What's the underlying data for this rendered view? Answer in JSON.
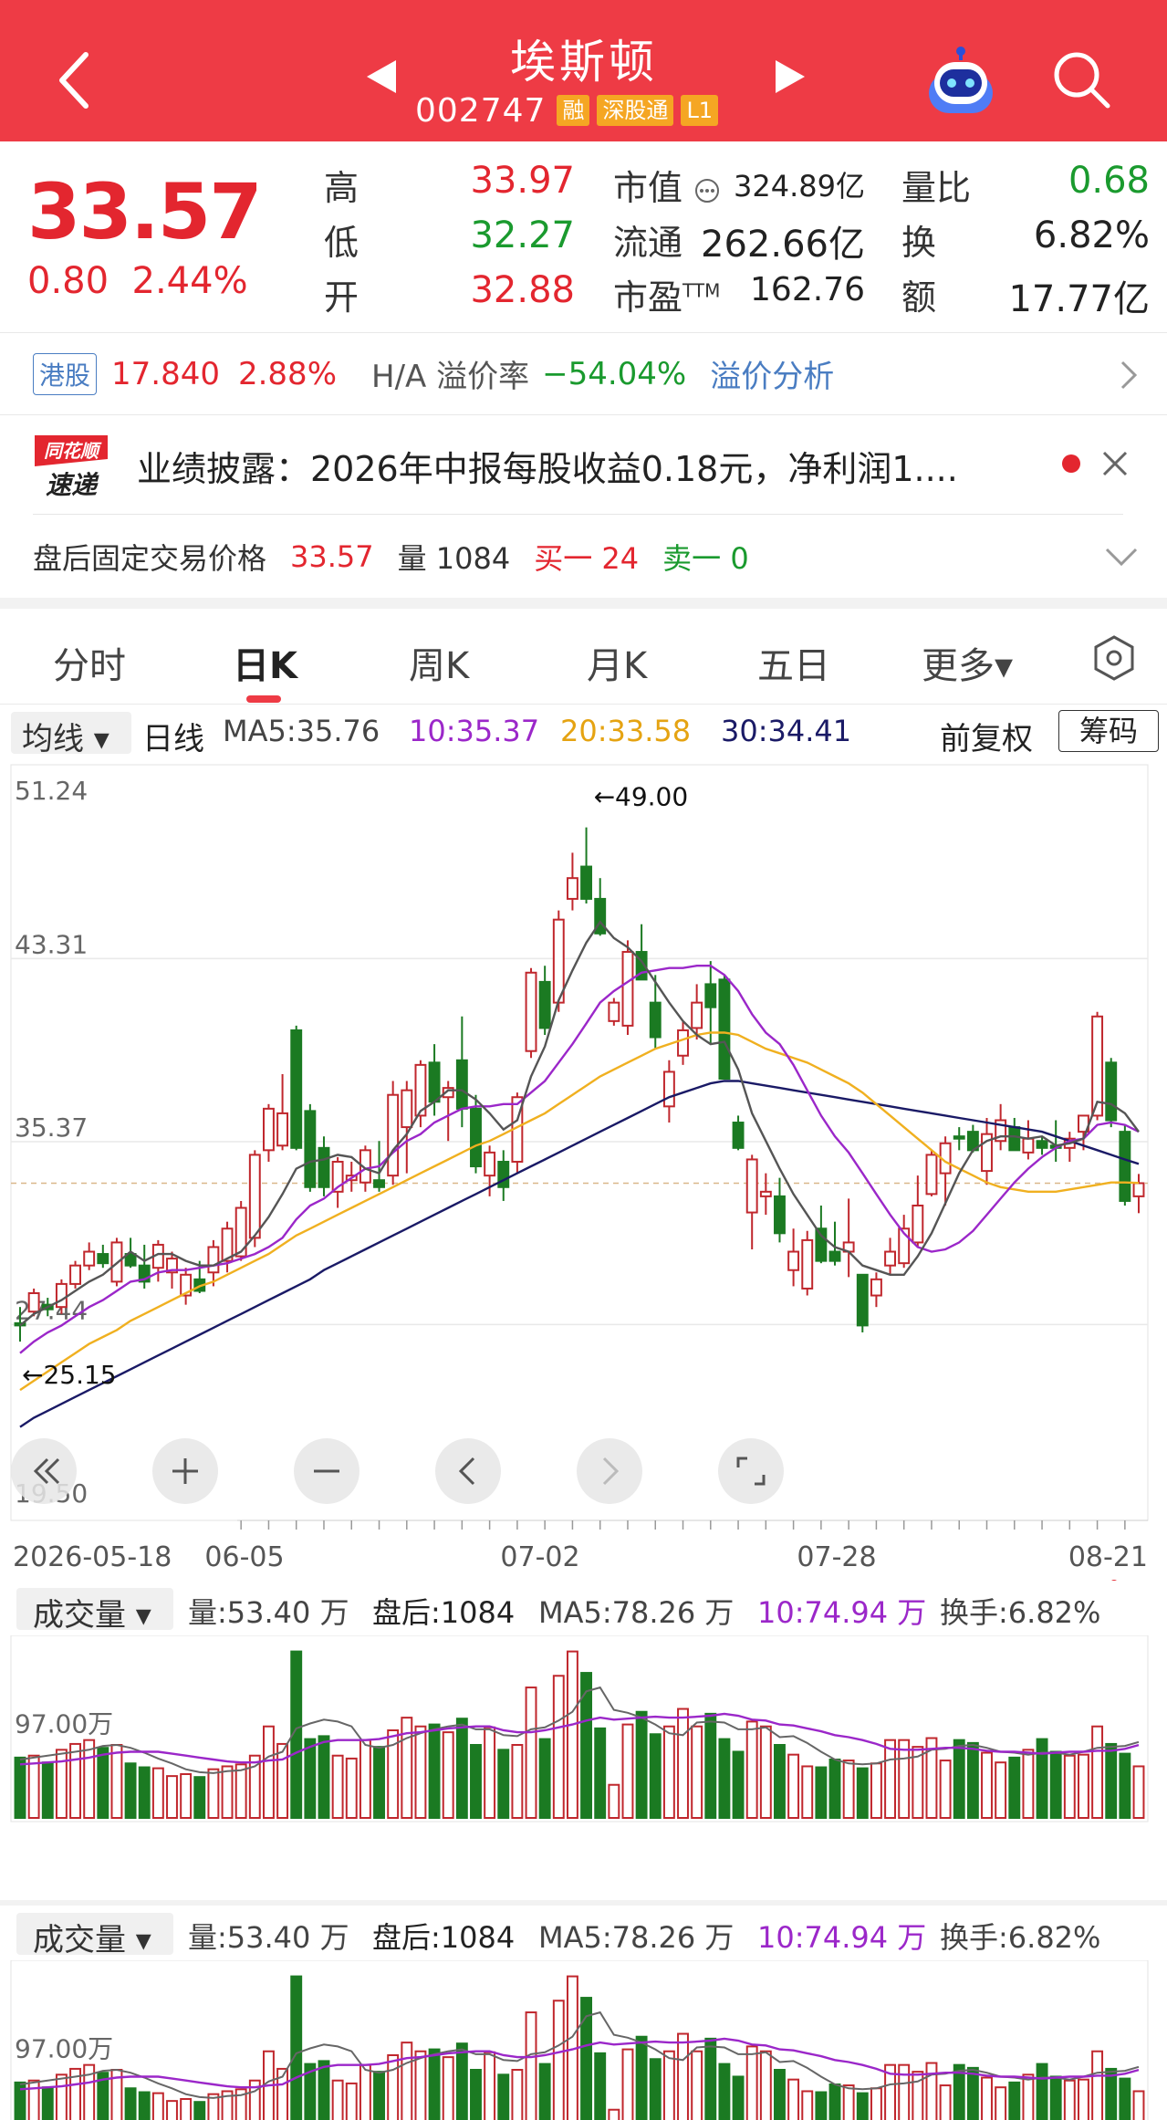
{
  "header": {
    "title": "埃斯顿",
    "code": "002747",
    "badges": [
      "融",
      "深股通",
      "L1"
    ]
  },
  "quote": {
    "price": "33.57",
    "change": "0.80",
    "change_pct": "2.44%",
    "labels": {
      "high": "高",
      "low": "低",
      "open": "开",
      "market_cap": "市值",
      "float_cap": "流通",
      "pe": "市盈",
      "pe_suffix": "TTM",
      "vol_ratio": "量比",
      "turnover": "换",
      "amount": "额"
    },
    "high": "33.97",
    "low": "32.27",
    "open": "32.88",
    "market_cap": "324.89亿",
    "float_cap": "262.66亿",
    "pe": "162.76",
    "vol_ratio": "0.68",
    "turnover": "6.82%",
    "amount": "17.77亿"
  },
  "hk": {
    "badge": "港股",
    "price": "17.840",
    "pct": "2.88%",
    "premium_label": "H/A 溢价率",
    "premium": "−54.04%",
    "link": "溢价分析"
  },
  "news": {
    "logo_top": "同花顺",
    "logo_bottom": "速递",
    "text": "业绩披露：2026年中报每股收益0.18元，净利润1...."
  },
  "afterhours": {
    "label": "盘后固定交易价格",
    "price": "33.57",
    "vol_label": "量 1084",
    "buy": "买一 24",
    "sell": "卖一 0"
  },
  "tabs": [
    "分时",
    "日K",
    "周K",
    "月K",
    "五日",
    "更多▾"
  ],
  "ma_bar": {
    "selector": "均线 ▾",
    "period": "日线",
    "ma5": "MA5:35.76",
    "ma10": "10:35.37",
    "ma20": "20:33.58",
    "ma30": "30:34.41",
    "adjust": "前复权",
    "chip": "筹码"
  },
  "colors": {
    "header": "#ee3b45",
    "up": "#c0272d",
    "down": "#1b7a22",
    "ma5": "#555555",
    "ma10": "#9b27c9",
    "ma20": "#f0b020",
    "ma30": "#1a1a66"
  },
  "chart_data": {
    "type": "candlestick",
    "y_ticks": [
      "51.24",
      "43.31",
      "35.37",
      "27.44",
      "19.50"
    ],
    "ylim": [
      19.5,
      51.24
    ],
    "x_ticks": [
      "2026-05-18",
      "06-05",
      "07-02",
      "07-28",
      "08-21"
    ],
    "max_label": "←49.00",
    "min_label": "←25.15",
    "ref_price": 33.57,
    "candles": [
      [
        27.5,
        28.2,
        26.7,
        27.4
      ],
      [
        28.0,
        29.0,
        27.8,
        28.8
      ],
      [
        28.3,
        28.6,
        27.8,
        28.1
      ],
      [
        28.2,
        29.4,
        27.9,
        29.2
      ],
      [
        29.2,
        30.2,
        29.0,
        30.0
      ],
      [
        30.0,
        31.0,
        29.8,
        30.6
      ],
      [
        30.5,
        30.9,
        29.9,
        30.1
      ],
      [
        29.3,
        31.2,
        29.1,
        31.0
      ],
      [
        30.5,
        31.2,
        29.9,
        30.0
      ],
      [
        30.0,
        30.9,
        29.0,
        29.3
      ],
      [
        29.9,
        31.1,
        29.3,
        30.9
      ],
      [
        29.7,
        30.6,
        29.0,
        30.3
      ],
      [
        28.7,
        29.9,
        28.3,
        29.6
      ],
      [
        29.4,
        30.2,
        28.8,
        28.9
      ],
      [
        29.7,
        31.1,
        29.1,
        30.8
      ],
      [
        30.2,
        31.9,
        29.7,
        31.6
      ],
      [
        30.4,
        32.8,
        30.2,
        32.5
      ],
      [
        31.2,
        35.0,
        30.8,
        34.8
      ],
      [
        35.0,
        37.0,
        34.5,
        36.8
      ],
      [
        35.2,
        38.3,
        35.0,
        36.6
      ],
      [
        40.2,
        40.4,
        35.0,
        35.1
      ],
      [
        36.7,
        37.0,
        33.2,
        33.4
      ],
      [
        35.1,
        35.6,
        33.0,
        33.4
      ],
      [
        33.2,
        34.7,
        32.5,
        34.5
      ],
      [
        33.7,
        34.5,
        33.2,
        33.9
      ],
      [
        33.6,
        35.2,
        33.2,
        35.0
      ],
      [
        33.7,
        35.4,
        33.2,
        33.4
      ],
      [
        33.9,
        38.0,
        33.5,
        37.4
      ],
      [
        36.0,
        38.0,
        34.0,
        37.6
      ],
      [
        36.5,
        38.9,
        36.0,
        38.7
      ],
      [
        38.8,
        39.6,
        36.5,
        37.1
      ],
      [
        37.3,
        38.0,
        35.4,
        37.7
      ],
      [
        38.9,
        40.8,
        36.0,
        36.8
      ],
      [
        36.8,
        37.4,
        34.0,
        34.3
      ],
      [
        33.9,
        35.2,
        33.0,
        34.9
      ],
      [
        34.5,
        35.0,
        32.8,
        33.4
      ],
      [
        34.5,
        37.5,
        34.0,
        37.3
      ],
      [
        39.3,
        42.9,
        39.0,
        42.7
      ],
      [
        42.3,
        43.0,
        40.0,
        40.3
      ],
      [
        41.4,
        45.4,
        41.0,
        45.0
      ],
      [
        45.9,
        47.9,
        45.4,
        46.8
      ],
      [
        47.3,
        49.0,
        45.7,
        45.9
      ],
      [
        45.9,
        46.8,
        44.3,
        44.4
      ],
      [
        40.6,
        41.6,
        40.4,
        41.4
      ],
      [
        40.4,
        44.1,
        40.0,
        43.6
      ],
      [
        43.6,
        44.8,
        42.4,
        42.4
      ],
      [
        41.4,
        42.6,
        39.4,
        39.9
      ],
      [
        36.9,
        38.9,
        36.2,
        38.4
      ],
      [
        39.1,
        40.6,
        38.7,
        40.2
      ],
      [
        40.3,
        42.2,
        39.8,
        41.4
      ],
      [
        42.2,
        43.2,
        39.6,
        41.2
      ],
      [
        42.4,
        42.6,
        38.1,
        38.1
      ],
      [
        36.2,
        36.5,
        35.0,
        35.1
      ],
      [
        32.3,
        34.8,
        30.7,
        34.6
      ],
      [
        33.0,
        34.0,
        32.2,
        33.2
      ],
      [
        33.0,
        33.8,
        31.0,
        31.4
      ],
      [
        29.8,
        31.6,
        29.1,
        30.6
      ],
      [
        29.0,
        31.5,
        28.7,
        31.1
      ],
      [
        31.6,
        32.6,
        30.1,
        30.2
      ],
      [
        30.6,
        31.9,
        30.0,
        30.2
      ],
      [
        30.6,
        32.9,
        29.5,
        31.0
      ],
      [
        29.6,
        29.6,
        27.1,
        27.4
      ],
      [
        28.7,
        29.7,
        28.2,
        29.4
      ],
      [
        30.0,
        31.2,
        29.6,
        30.6
      ],
      [
        30.1,
        32.2,
        29.9,
        31.6
      ],
      [
        31.0,
        33.9,
        30.8,
        32.6
      ],
      [
        33.1,
        35.0,
        33.0,
        34.8
      ],
      [
        34.0,
        35.6,
        32.6,
        35.3
      ],
      [
        35.6,
        36.0,
        35.0,
        35.5
      ],
      [
        35.8,
        36.1,
        34.9,
        35.0
      ],
      [
        34.1,
        36.4,
        33.5,
        35.7
      ],
      [
        35.4,
        37.0,
        35.0,
        36.3
      ],
      [
        36.0,
        36.4,
        35.0,
        35.0
      ],
      [
        34.9,
        36.3,
        34.6,
        35.5
      ],
      [
        35.4,
        35.6,
        34.8,
        35.1
      ],
      [
        35.2,
        36.3,
        34.5,
        35.1
      ],
      [
        35.1,
        35.8,
        34.5,
        35.5
      ],
      [
        35.8,
        36.2,
        35.0,
        36.5
      ],
      [
        36.5,
        41.0,
        36.3,
        40.8
      ],
      [
        38.8,
        39.0,
        36.0,
        36.3
      ],
      [
        35.8,
        36.1,
        32.6,
        32.8
      ],
      [
        33.0,
        33.97,
        32.27,
        33.57
      ]
    ],
    "ma5": [
      27.4,
      27.9,
      28.2,
      28.5,
      28.9,
      29.3,
      29.6,
      30.1,
      30.6,
      30.2,
      30.5,
      30.5,
      30.2,
      30.0,
      30.0,
      30.3,
      30.6,
      31.3,
      32.1,
      33.1,
      34.2,
      34.5,
      34.6,
      34.8,
      34.7,
      34.2,
      34.0,
      35.0,
      35.7,
      36.7,
      37.1,
      37.6,
      37.6,
      37.2,
      36.6,
      35.9,
      36.3,
      38.2,
      39.5,
      41.5,
      42.8,
      44.0,
      44.9,
      44.2,
      43.8,
      43.2,
      42.3,
      41.4,
      40.6,
      40.0,
      39.6,
      39.7,
      38.5,
      36.6,
      35.4,
      34.2,
      33.1,
      32.2,
      31.3,
      30.8,
      30.6,
      30.0,
      29.8,
      29.6,
      29.6,
      30.4,
      31.4,
      32.7,
      34.0,
      35.0,
      35.4,
      35.6,
      35.6,
      35.5,
      35.6,
      35.2,
      35.3,
      35.5,
      37.1,
      37.0,
      36.6,
      35.8
    ],
    "ma10": [
      26.2,
      26.7,
      27.1,
      27.4,
      27.8,
      28.2,
      28.5,
      28.9,
      29.3,
      29.4,
      29.7,
      29.8,
      29.8,
      29.9,
      30.0,
      30.1,
      30.3,
      30.5,
      30.8,
      31.2,
      32.0,
      32.6,
      32.9,
      33.4,
      33.8,
      34.2,
      34.3,
      34.9,
      35.4,
      35.7,
      36.2,
      36.5,
      36.8,
      36.9,
      36.9,
      37.0,
      37.0,
      37.5,
      38.0,
      38.8,
      39.6,
      40.5,
      41.4,
      41.9,
      42.3,
      42.7,
      42.8,
      42.9,
      42.9,
      43.0,
      43.0,
      42.6,
      41.9,
      40.9,
      40.1,
      39.6,
      38.7,
      37.6,
      36.5,
      35.6,
      34.9,
      34.0,
      33.1,
      32.2,
      31.4,
      30.8,
      30.6,
      30.7,
      31.0,
      31.5,
      32.2,
      32.9,
      33.6,
      34.2,
      34.7,
      35.1,
      35.4,
      35.5,
      36.1,
      36.2,
      36.1,
      35.8
    ],
    "ma20": [
      24.6,
      25.0,
      25.4,
      25.8,
      26.2,
      26.6,
      26.9,
      27.2,
      27.6,
      27.9,
      28.2,
      28.5,
      28.8,
      29.1,
      29.3,
      29.6,
      29.9,
      30.2,
      30.5,
      30.9,
      31.3,
      31.6,
      31.9,
      32.2,
      32.5,
      32.8,
      33.1,
      33.4,
      33.7,
      34.0,
      34.3,
      34.6,
      34.9,
      35.2,
      35.4,
      35.7,
      36.0,
      36.3,
      36.6,
      37.0,
      37.4,
      37.8,
      38.2,
      38.5,
      38.8,
      39.1,
      39.4,
      39.6,
      39.8,
      40.0,
      40.1,
      40.1,
      40.0,
      39.7,
      39.4,
      39.2,
      39.0,
      38.8,
      38.5,
      38.2,
      37.9,
      37.5,
      37.0,
      36.5,
      36.0,
      35.5,
      35.0,
      34.5,
      34.2,
      33.9,
      33.6,
      33.4,
      33.3,
      33.2,
      33.2,
      33.2,
      33.3,
      33.4,
      33.5,
      33.6,
      33.6,
      33.58
    ],
    "ma30": [
      23.0,
      23.4,
      23.7,
      24.0,
      24.3,
      24.6,
      24.9,
      25.2,
      25.5,
      25.8,
      26.1,
      26.4,
      26.7,
      27.0,
      27.3,
      27.6,
      27.9,
      28.2,
      28.5,
      28.8,
      29.1,
      29.4,
      29.8,
      30.1,
      30.4,
      30.7,
      31.0,
      31.3,
      31.6,
      31.9,
      32.2,
      32.5,
      32.8,
      33.1,
      33.4,
      33.7,
      34.0,
      34.3,
      34.6,
      34.9,
      35.2,
      35.5,
      35.8,
      36.1,
      36.4,
      36.7,
      37.0,
      37.3,
      37.5,
      37.7,
      37.9,
      38.0,
      38.0,
      37.9,
      37.8,
      37.7,
      37.6,
      37.5,
      37.4,
      37.3,
      37.2,
      37.1,
      37.0,
      36.9,
      36.8,
      36.7,
      36.6,
      36.5,
      36.4,
      36.3,
      36.2,
      36.1,
      36.0,
      35.9,
      35.8,
      35.6,
      35.4,
      35.2,
      35.0,
      34.8,
      34.6,
      34.41
    ],
    "volume_panels": [
      {
        "selector": "成交量 ▾",
        "vol": "量:53.40 万",
        "after": "盘后:1084",
        "ma5": "MA5:78.26 万",
        "ma10": "10:74.94 万",
        "turnover": "换手:6.82%",
        "y_tick": "97.00万"
      },
      {
        "selector": "成交量 ▾",
        "vol": "量:53.40 万",
        "after": "盘后:1084",
        "ma5": "MA5:78.26 万",
        "ma10": "10:74.94 万",
        "turnover": "换手:6.82%",
        "y_tick": "97.00万"
      }
    ],
    "volumes": [
      62,
      64,
      57,
      70,
      76,
      80,
      72,
      75,
      56,
      52,
      51,
      43,
      45,
      42,
      50,
      53,
      55,
      64,
      94,
      76,
      171,
      81,
      84,
      64,
      61,
      80,
      73,
      90,
      103,
      94,
      96,
      88,
      102,
      75,
      93,
      70,
      75,
      134,
      81,
      146,
      171,
      149,
      92,
      34,
      96,
      109,
      86,
      94,
      112,
      94,
      107,
      81,
      68,
      99,
      94,
      75,
      65,
      53,
      52,
      60,
      59,
      51,
      56,
      80,
      80,
      73,
      82,
      59,
      80,
      77,
      67,
      57,
      62,
      70,
      81,
      68,
      64,
      65,
      94,
      76,
      66,
      53
    ],
    "vol_ma5": [
      60,
      62,
      64,
      66,
      68,
      70,
      74,
      75,
      72,
      67,
      61,
      56,
      50,
      47,
      46,
      48,
      49,
      53,
      63,
      68,
      92,
      97,
      101,
      99,
      94,
      75,
      72,
      75,
      82,
      87,
      91,
      94,
      96,
      91,
      91,
      85,
      84,
      91,
      93,
      100,
      109,
      130,
      134,
      111,
      108,
      103,
      96,
      87,
      85,
      98,
      99,
      98,
      91,
      91,
      93,
      83,
      84,
      77,
      68,
      60,
      56,
      55,
      56,
      60,
      61,
      63,
      70,
      71,
      74,
      75,
      72,
      68,
      67,
      65,
      67,
      67,
      65,
      68,
      72,
      73,
      74,
      78
    ],
    "vol_ma10": [
      55,
      56,
      57,
      58,
      60,
      62,
      65,
      67,
      68,
      68,
      68,
      66,
      64,
      62,
      60,
      58,
      57,
      57,
      59,
      60,
      67,
      73,
      78,
      80,
      80,
      80,
      81,
      84,
      87,
      88,
      90,
      92,
      93,
      94,
      94,
      90,
      88,
      88,
      90,
      93,
      96,
      100,
      103,
      101,
      102,
      103,
      104,
      103,
      103,
      104,
      105,
      107,
      105,
      101,
      100,
      96,
      95,
      92,
      89,
      85,
      83,
      80,
      76,
      71,
      70,
      70,
      71,
      72,
      72,
      71,
      69,
      68,
      68,
      67,
      66,
      67,
      68,
      68,
      69,
      69,
      71,
      74.94
    ]
  }
}
